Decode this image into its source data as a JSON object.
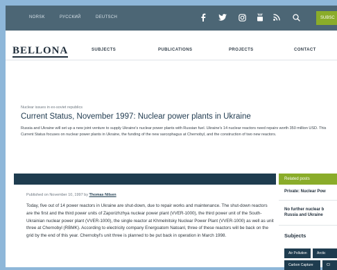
{
  "languages": [
    "NORSK",
    "РУССКИЙ",
    "DEUTSCH"
  ],
  "topbar_icons": [
    "facebook-icon",
    "twitter-icon",
    "instagram-icon",
    "youtube-icon",
    "rss-icon",
    "search-icon"
  ],
  "subscribe_label": "SUBSC",
  "logo": "BELLONA",
  "nav": [
    "SUBJECTS",
    "PUBLICATIONS",
    "PROJECTS",
    "CONTACT"
  ],
  "article": {
    "breadcrumb": "Nuclear issues in ex-soviet republics",
    "title": "Current Status, November 1997: Nuclear power plants in Ukraine",
    "lead": "Russia and Ukraine will set up a new joint venture to supply Ukraine's nuclear power plants with Russian fuel. Ukraine's 14 nuclear reactors need repairs worth 350 million USD. This Current Status focuses on nuclear power plants in Ukraine, the funding of the new sarcophagus at Chernobyl, and the construction of two new reactors.",
    "published_prefix": "Published on November 10, 1997 by",
    "author": "Thomas Nilsen",
    "body": "Today, five out of 14 power reactors in Ukraine are shut-down, due to repair works and maintenance. The shut-down reactors are the first and the third power units of Zaporizhzhya nuclear power plant (VVER-1000), the third power unit of the South-Ukrainian nuclear power plant (VVER-1000), the single reactor at Khmelnitsky Nuclear Power Plant (VVER-1000) as well as unit three at Chernobyl (RBMK). According to electricity company Energoatom Natoanl, three of these reactors will be back on the grid by the end of this year. Chernobyl's unit three is planned to be put back in operation in March 1998."
  },
  "sidebar": {
    "related_title": "Related posts",
    "related_posts": [
      {
        "line1": "Private: Nuclear Pow"
      },
      {
        "line1": "No further nuclear b",
        "line2": "Russia and Ukraine"
      }
    ],
    "subjects_title": "Subjects",
    "tags": [
      "Air Pollution",
      "Arctic",
      "Carbon Capture",
      "Cl"
    ]
  }
}
